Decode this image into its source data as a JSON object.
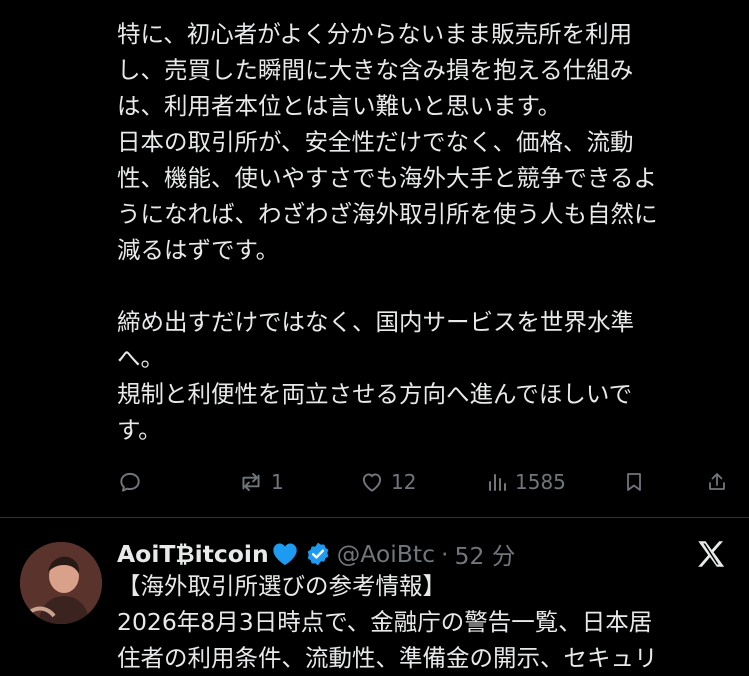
{
  "post": {
    "lines": [
      "特に、初心者がよく分からないまま販売所を利用",
      "し、売買した瞬間に大きな含み損を抱える仕組み",
      "は、利用者本位とは言い難いと思います。",
      "日本の取引所が、安全性だけでなく、価格、流動",
      "性、機能、使いやすさでも海外大手と競争できるよ",
      "うになれば、わざわざ海外取引所を使う人も自然に",
      "減るはずです。",
      "",
      "締め出すだけではなく、国内サービスを世界水準",
      "へ。",
      "規制と利便性を両立させる方向へ進んでほしいで",
      "す。"
    ],
    "actions": {
      "reposts": "1",
      "likes": "12",
      "views": "1585"
    }
  },
  "reply": {
    "display_name": "AoiT₿itcoin",
    "heart_emoji": "💙",
    "handle": "@AoiBtc",
    "separator": "·",
    "time": "52 分",
    "lines": [
      "【海外取引所選びの参考情報】",
      "2026年8月3日時点で、金融庁の警告一覧、日本居",
      "住者の利用条件、流動性、準備金の開示、セキュリ"
    ]
  },
  "icons": {
    "reply": "reply-icon",
    "repost": "repost-icon",
    "like": "heart-icon",
    "views": "views-icon",
    "bookmark": "bookmark-icon",
    "share": "share-icon",
    "verified": "verified-badge-icon",
    "close": "x-logo-icon"
  },
  "colors": {
    "background": "#000000",
    "text": "#e7e9ea",
    "muted": "#71767b",
    "divider": "#2f3336",
    "verified": "#1d9bf0",
    "heart_emoji": "#1d9bf0"
  }
}
